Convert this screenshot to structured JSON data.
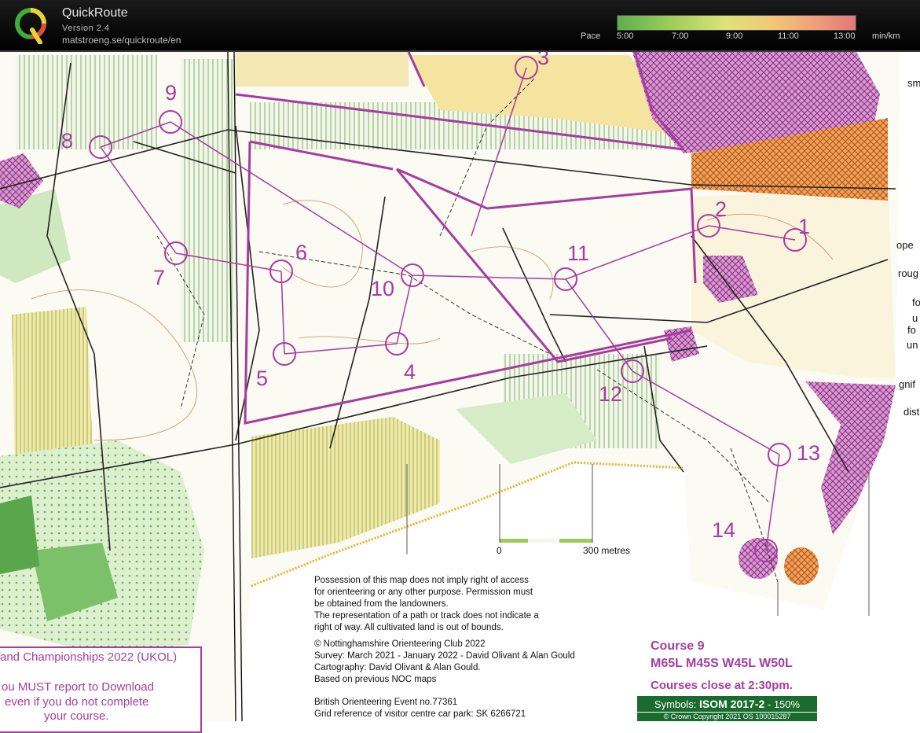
{
  "app": {
    "name": "QuickRoute",
    "version": "Version 2.4",
    "url": "matstroeng.se/quickroute/en",
    "logo_letter": "Q"
  },
  "pace": {
    "label": "Pace",
    "ticks": [
      "5:00",
      "7:00",
      "9:00",
      "11:00",
      "13:00"
    ],
    "unit": "min/km",
    "colors": [
      "#5fae4e",
      "#9ccc5a",
      "#dde27a",
      "#f2c878",
      "#ef9a7a",
      "#e07878"
    ]
  },
  "map": {
    "controls": [
      "1",
      "2",
      "3",
      "4",
      "5",
      "6",
      "7",
      "8",
      "9",
      "10",
      "11",
      "12",
      "13",
      "14"
    ],
    "scale": {
      "start": "0",
      "end": "300 metres"
    },
    "right_edge_words": [
      "sm",
      "ope",
      "roug",
      "fo",
      "u",
      "fo",
      "un",
      "gnif",
      "dist"
    ],
    "colors": {
      "course": "#a63ca0",
      "forest_green": "#3f9a3a",
      "open_yellow": "#f3d98a",
      "oob_orange": "#e07a2a"
    }
  },
  "notice": [
    "Possession of this map does not imply right of access",
    "for orienteering or any other purpose. Permission must",
    "be obtained from the landowners.",
    "The representation of a path or track does not indicate a",
    "right of way. All cultivated land is out of bounds."
  ],
  "credits": [
    "© Nottinghamshire Orienteering Club 2022",
    "Survey: March 2021 - January 2022 - David Olivant & Alan Gould",
    "Cartography: David Olivant & Alan Gould.",
    "Based on previous NOC maps"
  ],
  "event": [
    "British Orienteering Event no.77361",
    "Grid reference of visitor centre car park: SK 6266721"
  ],
  "course": {
    "title": "Course 9",
    "classes": "M65L M45S W45L W50L",
    "close": "Courses close at 2:30pm.",
    "symbols_prefix": "Symbols: ",
    "symbols_spec": "ISOM 2017-2",
    "symbols_suffix": " - 150%",
    "copyright": "© Crown Copyright 2021 OS 100015287"
  },
  "championships": {
    "title": "and Championships 2022 (UKOL)",
    "lines": [
      "ou MUST report to Download",
      "even if you do not complete",
      "your course."
    ]
  }
}
